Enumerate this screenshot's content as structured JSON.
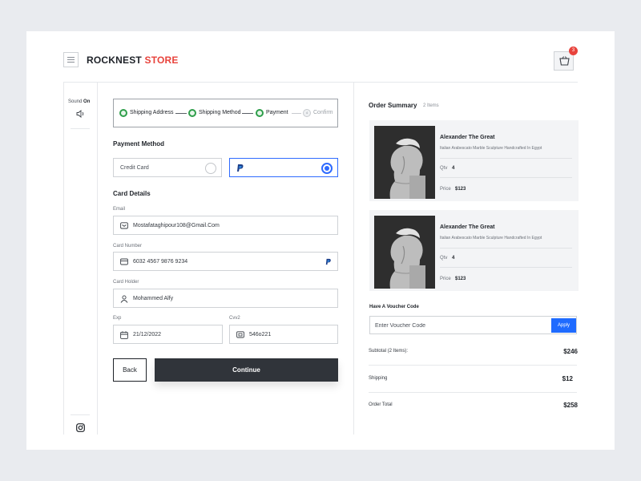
{
  "brand": {
    "name_part1": "ROCKNEST",
    "name_part2": "STORE",
    "accent": "#e8433c"
  },
  "header": {
    "cart_count": "3",
    "menu_icon": "hamburger-icon",
    "cart_icon": "basket-icon"
  },
  "sidebar": {
    "sound_label": "Sound",
    "sound_state": "On",
    "speaker_icon": "speaker-icon",
    "instagram_icon": "instagram-icon"
  },
  "stepper": {
    "steps": [
      {
        "label": "Shipping Address",
        "done": true
      },
      {
        "label": "Shipping Method",
        "done": true
      },
      {
        "label": "Payment",
        "done": true
      },
      {
        "label": "Confirm",
        "done": false,
        "number": "4"
      }
    ]
  },
  "payment": {
    "title": "Payment Method",
    "options": [
      {
        "label": "Credit Card",
        "selected": false
      },
      {
        "label": "PayPal",
        "icon": "paypal-icon",
        "selected": true
      }
    ]
  },
  "card_details": {
    "title": "Card Details",
    "email": {
      "label": "Email",
      "value": "Mostafataghipour108@Gmail.Com"
    },
    "card_number": {
      "label": "Card Number",
      "value": "6032  4567  9876  9234"
    },
    "card_holder": {
      "label": "Card Holder",
      "value": "Mohammed Alfy"
    },
    "exp": {
      "label": "Exp",
      "value": "21/12/2022"
    },
    "cvv": {
      "label": "Cvv2",
      "value": "546o221"
    }
  },
  "actions": {
    "back": "Back",
    "continue": "Continue"
  },
  "summary": {
    "title": "Order Summary",
    "count": "2 Items",
    "items": [
      {
        "name": "Alexander The Great",
        "desc": "Italian Arabescato Marble Sculpture Handcrafted In Egypt",
        "qty_label": "Qtv",
        "qty": "4",
        "price_label": "Price",
        "price": "$123"
      },
      {
        "name": "Alexander The Great",
        "desc": "Italian Arabescato Marble Sculpture Handcrafted In Egypt",
        "qty_label": "Qtv",
        "qty": "4",
        "price_label": "Price",
        "price": "$123"
      }
    ],
    "voucher": {
      "label": "Have A Voucher Code",
      "placeholder": "Enter Voucher Code",
      "apply": "Apply"
    },
    "totals": [
      {
        "label": "Subtotal (2 Items):",
        "value": "$246"
      },
      {
        "label": "Shipping",
        "value": "$12"
      },
      {
        "label": "Order Total",
        "value": "$258"
      }
    ]
  },
  "colors": {
    "primary": "#1f6bff",
    "success": "#2e9e4a",
    "dark_button": "#30343a"
  }
}
